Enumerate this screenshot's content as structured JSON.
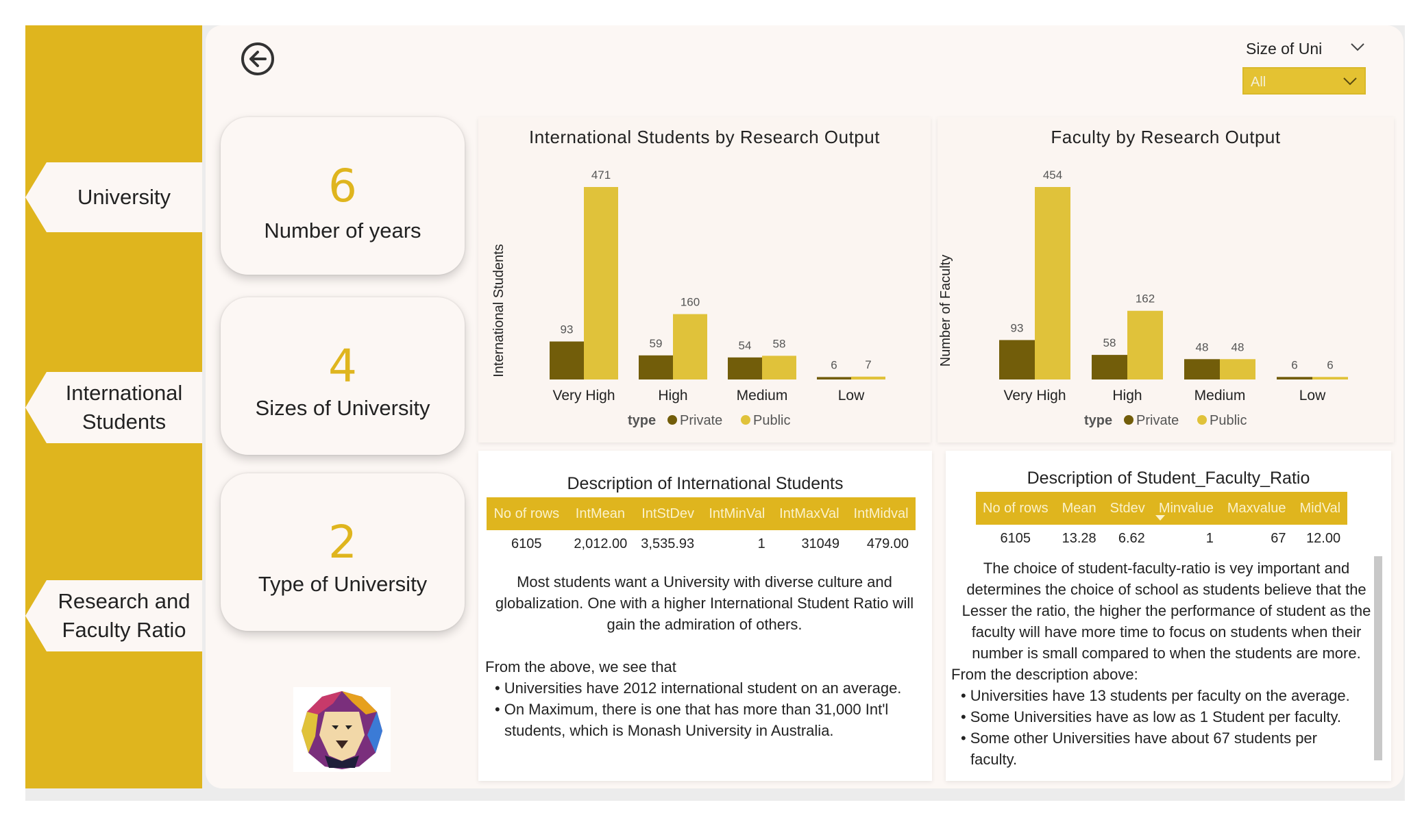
{
  "colors": {
    "sidebar": "#dfb51e",
    "private": "#725d0a",
    "public": "#e0c23a",
    "accent": "#dfb51e"
  },
  "nav": [
    {
      "label": "University"
    },
    {
      "label": "International Students"
    },
    {
      "label": "Research and Faculty Ratio"
    }
  ],
  "back_icon": "arrow-left-circle-icon",
  "slicer": {
    "title": "Size of Uni",
    "value": "All"
  },
  "cards": [
    {
      "value": "6",
      "label": "Number of years"
    },
    {
      "value": "4",
      "label": "Sizes of University"
    },
    {
      "value": "2",
      "label": "Type of University"
    }
  ],
  "chart_data": [
    {
      "type": "bar",
      "title": "International Students by Research Output",
      "ylabel": "International Students",
      "xlabel": "",
      "categories": [
        "Very High",
        "High",
        "Medium",
        "Low"
      ],
      "series": [
        {
          "name": "Private",
          "values": [
            93,
            59,
            54,
            6
          ]
        },
        {
          "name": "Public",
          "values": [
            471,
            160,
            58,
            7
          ]
        }
      ],
      "legend_title": "type",
      "legend_position": "bottom",
      "ylim": [
        0,
        471
      ],
      "grid": false
    },
    {
      "type": "bar",
      "title": "Faculty by Research Output",
      "ylabel": "Number of Faculty",
      "xlabel": "",
      "categories": [
        "Very High",
        "High",
        "Medium",
        "Low"
      ],
      "series": [
        {
          "name": "Private",
          "values": [
            93,
            58,
            48,
            6
          ]
        },
        {
          "name": "Public",
          "values": [
            454,
            162,
            48,
            6
          ]
        }
      ],
      "legend_title": "type",
      "legend_position": "bottom",
      "ylim": [
        0,
        454
      ],
      "grid": false
    }
  ],
  "desc_int": {
    "title": "Description of International Students",
    "headers": [
      "No of rows",
      "IntMean",
      "IntStDev",
      "IntMinVal",
      "IntMaxVal",
      "IntMidval"
    ],
    "row": [
      "6105",
      "2,012.00",
      "3,535.93",
      "1",
      "31049",
      "479.00"
    ],
    "intro": "Most students want a University with diverse culture and globalization. One with a higher International Student Ratio will gain the admiration of others.",
    "lead": "From the above, we see that",
    "bullets": [
      "Universities have 2012 international student on an average.",
      "On Maximum, there is one that has more than 31,000 Int'l students, which is Monash University in Australia."
    ]
  },
  "desc_sfr": {
    "title": "Description of Student_Faculty_Ratio",
    "headers": [
      "No of rows",
      "Mean",
      "Stdev",
      "Minvalue",
      "Maxvalue",
      "MidVal"
    ],
    "row": [
      "6105",
      "13.28",
      "6.62",
      "1",
      "67",
      "12.00"
    ],
    "intro": "The choice of student-faculty-ratio is vey important and determines the choice of school as students believe that the Lesser the ratio, the higher the performance of student as the faculty will have more time to focus on students when their number is small compared to when the students are more.",
    "lead": "From the description above:",
    "bullets": [
      "Universities have 13 students per faculty on the average.",
      "Some Universities have as low as 1 Student per faculty.",
      "Some other Universities have about 67 students per faculty."
    ]
  },
  "logo": "lion-logo"
}
